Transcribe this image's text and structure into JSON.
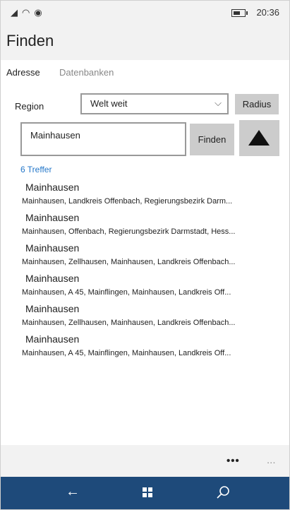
{
  "statusbar": {
    "signal_icon": "signal-icon",
    "wifi_icon": "wifi-icon",
    "location_icon": "location-icon",
    "battery_icon": "battery-icon",
    "time": "20:36"
  },
  "app": {
    "title": "Finden"
  },
  "tabs": [
    {
      "label": "Adresse",
      "active": true
    },
    {
      "label": "Datenbanken",
      "active": false
    }
  ],
  "form": {
    "region_label": "Region",
    "region_value": "Welt weit",
    "radius_label": "Radius",
    "search_value": "Mainhausen",
    "find_label": "Finden"
  },
  "results_count": "6 Treffer",
  "results": [
    {
      "title": "Mainhausen",
      "subtitle": "Mainhausen, Landkreis Offenbach, Regierungsbezirk Darm..."
    },
    {
      "title": "Mainhausen",
      "subtitle": "Mainhausen, Offenbach, Regierungsbezirk Darmstadt, Hess..."
    },
    {
      "title": "Mainhausen",
      "subtitle": "Mainhausen, Zellhausen, Mainhausen, Landkreis Offenbach..."
    },
    {
      "title": "Mainhausen",
      "subtitle": "Mainhausen, A 45, Mainflingen, Mainhausen, Landkreis Off..."
    },
    {
      "title": "Mainhausen",
      "subtitle": "Mainhausen, Zellhausen, Mainhausen, Landkreis Offenbach..."
    },
    {
      "title": "Mainhausen",
      "subtitle": "Mainhausen, A 45, Mainflingen, Mainhausen, Landkreis Off..."
    }
  ],
  "appbar": {
    "dots": "•••",
    "more": "..."
  },
  "navbar": {
    "back_icon": "back-arrow-icon",
    "windows_icon": "windows-icon",
    "search_icon": "search-icon"
  },
  "colors": {
    "accent_link": "#2477c9",
    "navbar_bg": "#1e4a7a",
    "button_bg": "#cccccc"
  }
}
